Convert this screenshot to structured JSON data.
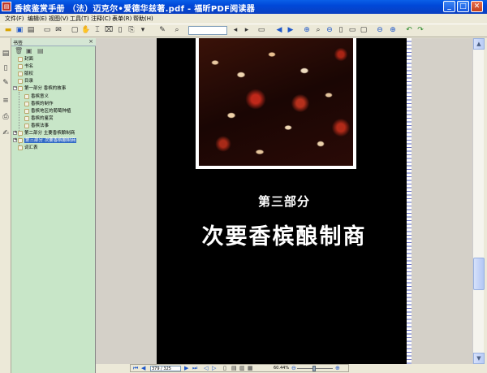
{
  "window": {
    "title": "香槟鉴赏手册 （法）迈克尔•爱德华兹著.pdf - 福昕PDF阅读器",
    "app_icon": "pdf-app-icon",
    "buttons": {
      "minimize": "_",
      "maximize": "□",
      "close": "✕"
    }
  },
  "menu": [
    {
      "label": "文件(F)"
    },
    {
      "label": "编辑(E)"
    },
    {
      "label": "视图(V)"
    },
    {
      "label": "工具(T)"
    },
    {
      "label": "注释(C)"
    },
    {
      "label": "表单(R)"
    },
    {
      "label": "帮助(H)"
    }
  ],
  "bookmarks": {
    "header": "书签",
    "items": [
      {
        "label": "封面",
        "level": 0
      },
      {
        "label": "书名",
        "level": 0
      },
      {
        "label": "版权",
        "level": 0
      },
      {
        "label": "目录",
        "level": 0
      },
      {
        "label": "第一部分 香槟的故事",
        "level": 0,
        "expanded": true
      },
      {
        "label": "香槟意义",
        "level": 1
      },
      {
        "label": "香槟的制作",
        "level": 1
      },
      {
        "label": "香槟地区的葡萄种植",
        "level": 1
      },
      {
        "label": "香槟的鉴赏",
        "level": 1
      },
      {
        "label": "香槟法事",
        "level": 1
      },
      {
        "label": "第二部分 主要香槟酿制商",
        "level": 0,
        "collapsed": true
      },
      {
        "label": "第三部分 次要香槟酿制商",
        "level": 0,
        "collapsed": true,
        "selected": true
      },
      {
        "label": "词汇表",
        "level": 0
      }
    ]
  },
  "page": {
    "part_title": "第三部分",
    "main_title": "次要香槟酿制商"
  },
  "navigation": {
    "page_field": "379 / 325",
    "zoom": "60.44%"
  }
}
